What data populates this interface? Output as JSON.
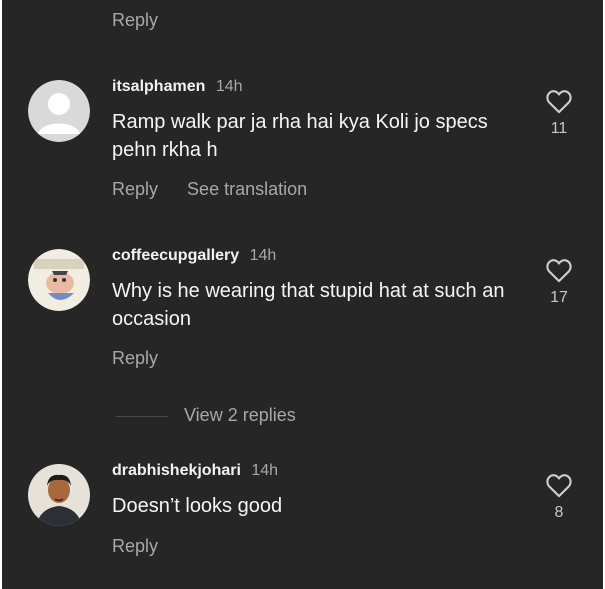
{
  "top_reply_label": "Reply",
  "comments": [
    {
      "username": "itsalphamen",
      "time": "14h",
      "text": "Ramp walk par ja rha hai kya Koli jo specs pehn rkha h",
      "actions": [
        "Reply",
        "See translation"
      ],
      "likes": "11",
      "avatar": "default-avatar-icon"
    },
    {
      "username": "coffeecupgallery",
      "time": "14h",
      "text": "Why is he wearing that stupid hat at such an occasion",
      "actions": [
        "Reply"
      ],
      "likes": "17",
      "avatar": "cartoon-avatar"
    },
    {
      "username": "drabhishekjohari",
      "time": "14h",
      "text": "Doesn’t looks good",
      "actions": [
        "Reply"
      ],
      "likes": "8",
      "avatar": "photo-avatar"
    }
  ],
  "view_replies_label": "View 2 replies",
  "colors": {
    "background": "#262626",
    "primary_text": "#f5f5f5",
    "secondary_text": "#a8a8a8"
  },
  "icons": {
    "like": "heart-outline-icon"
  }
}
